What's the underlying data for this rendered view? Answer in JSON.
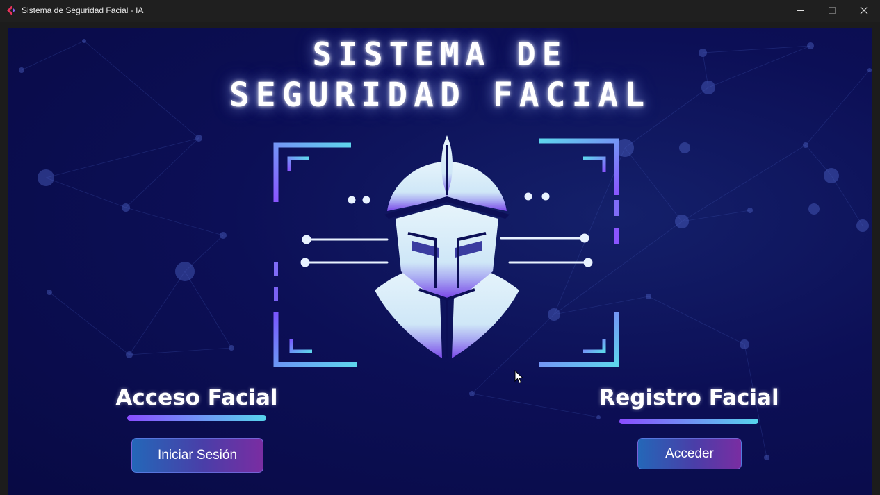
{
  "window": {
    "title": "Sistema de Seguridad Facial - IA",
    "controls": [
      "minimize-icon",
      "maximize-icon",
      "close-icon"
    ]
  },
  "header": {
    "title_line_1": "SISTEMA DE",
    "title_line_2": "SEGURIDAD FACIAL"
  },
  "emblem": {
    "icon": "knight-helmet-face-scan-icon"
  },
  "access": {
    "title": "Acceso Facial",
    "button_label": "Iniciar Sesión"
  },
  "register": {
    "title": "Registro Facial",
    "button_label": "Acceder"
  },
  "colors": {
    "background": "#0a0c4e",
    "accent_purple": "#8a4dff",
    "accent_cyan": "#57d4ec",
    "button_start": "#2467b8",
    "button_end": "#7a2da2",
    "text": "#ffffff"
  }
}
